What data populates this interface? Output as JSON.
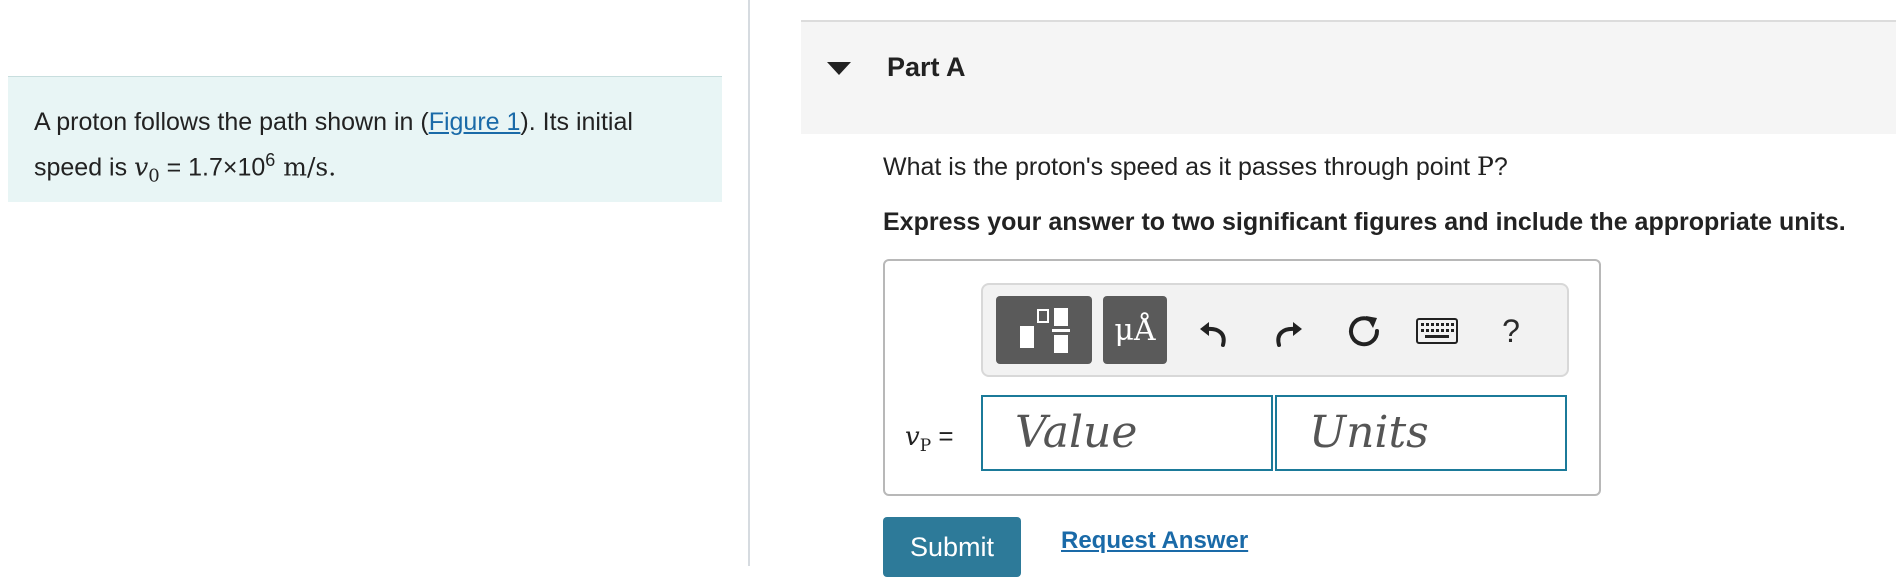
{
  "problem": {
    "text_before_link": "A proton follows the path shown in (",
    "figure_link": "Figure 1",
    "text_after_link": "). Its initial",
    "line2_prefix": "speed is ",
    "speed_symbol": "v",
    "speed_subscript": "0",
    "speed_equals": " = 1.7×10",
    "speed_exponent": "6",
    "speed_unit": " m/s."
  },
  "part": {
    "title": "Part A",
    "question_prefix": "What is the proton's speed as it passes through point ",
    "question_point": "P",
    "question_suffix": "?",
    "instruction": "Express your answer to two significant figures and include the appropriate units."
  },
  "toolbar": {
    "units_symbol": "μÅ",
    "help_label": "?"
  },
  "answer": {
    "var_symbol": "v",
    "var_subscript": "P",
    "var_equals": " =",
    "value_placeholder": "Value",
    "units_placeholder": "Units"
  },
  "actions": {
    "submit_label": "Submit",
    "request_label": "Request Answer"
  },
  "colors": {
    "accent": "#2d7a99",
    "link": "#1a6aa8",
    "problem_bg": "#e8f5f5"
  }
}
